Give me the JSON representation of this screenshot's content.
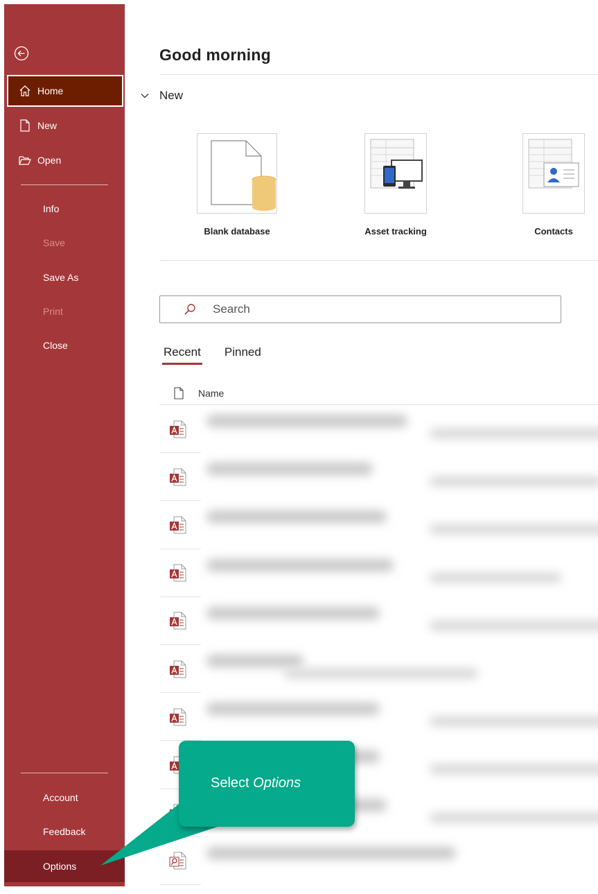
{
  "sidebar": {
    "items": {
      "home": {
        "label": "Home",
        "icon": "home-icon"
      },
      "new": {
        "label": "New",
        "icon": "new-document-icon"
      },
      "open": {
        "label": "Open",
        "icon": "folder-open-icon"
      },
      "info": {
        "label": "Info"
      },
      "save": {
        "label": "Save"
      },
      "save_as": {
        "label": "Save As"
      },
      "print": {
        "label": "Print"
      },
      "close": {
        "label": "Close"
      },
      "account": {
        "label": "Account"
      },
      "feedback": {
        "label": "Feedback"
      },
      "options": {
        "label": "Options"
      }
    },
    "back_icon": "back-arrow-icon"
  },
  "main": {
    "greeting": "Good morning",
    "new_section": {
      "label": "New",
      "icon": "chevron-down-icon"
    },
    "templates": [
      {
        "label": "Blank database",
        "icon": "blank-database-icon"
      },
      {
        "label": "Asset tracking",
        "icon": "asset-tracking-icon"
      },
      {
        "label": "Contacts",
        "icon": "contacts-icon"
      }
    ],
    "search": {
      "placeholder": "Search",
      "icon": "search-icon"
    },
    "tabs": {
      "recent": "Recent",
      "pinned": "Pinned"
    },
    "columns": {
      "name": "Name",
      "icon": "file-icon"
    }
  },
  "callout": {
    "prefix": "Select ",
    "emphasis": "Options"
  },
  "colors": {
    "sidebar": "#a4373a",
    "active": "#6e1e00",
    "callout": "#05a98b",
    "access": "#a4373a"
  }
}
